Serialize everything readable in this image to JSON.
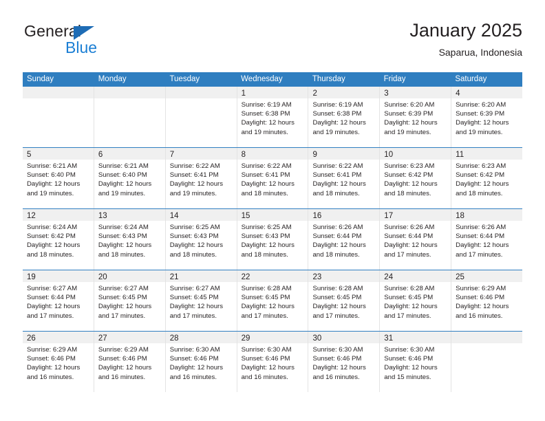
{
  "brand": {
    "line1": "General",
    "line2": "Blue",
    "triangle_icon": "triangle-icon",
    "color_dark": "#231f20",
    "color_blue": "#1c7fd4"
  },
  "header": {
    "title": "January 2025",
    "subtitle": "Saparua, Indonesia"
  },
  "theme": {
    "header_bg": "#2f7ec0",
    "daynum_bg": "#f0f0f0",
    "grid_line": "#e3e3e3",
    "text": "#231f20"
  },
  "weekdays": [
    "Sunday",
    "Monday",
    "Tuesday",
    "Wednesday",
    "Thursday",
    "Friday",
    "Saturday"
  ],
  "weeks": [
    [
      {
        "day": "",
        "sunrise": "",
        "sunset": "",
        "daylight_1": "",
        "daylight_2": ""
      },
      {
        "day": "",
        "sunrise": "",
        "sunset": "",
        "daylight_1": "",
        "daylight_2": ""
      },
      {
        "day": "",
        "sunrise": "",
        "sunset": "",
        "daylight_1": "",
        "daylight_2": ""
      },
      {
        "day": "1",
        "sunrise": "Sunrise: 6:19 AM",
        "sunset": "Sunset: 6:38 PM",
        "daylight_1": "Daylight: 12 hours",
        "daylight_2": "and 19 minutes."
      },
      {
        "day": "2",
        "sunrise": "Sunrise: 6:19 AM",
        "sunset": "Sunset: 6:38 PM",
        "daylight_1": "Daylight: 12 hours",
        "daylight_2": "and 19 minutes."
      },
      {
        "day": "3",
        "sunrise": "Sunrise: 6:20 AM",
        "sunset": "Sunset: 6:39 PM",
        "daylight_1": "Daylight: 12 hours",
        "daylight_2": "and 19 minutes."
      },
      {
        "day": "4",
        "sunrise": "Sunrise: 6:20 AM",
        "sunset": "Sunset: 6:39 PM",
        "daylight_1": "Daylight: 12 hours",
        "daylight_2": "and 19 minutes."
      }
    ],
    [
      {
        "day": "5",
        "sunrise": "Sunrise: 6:21 AM",
        "sunset": "Sunset: 6:40 PM",
        "daylight_1": "Daylight: 12 hours",
        "daylight_2": "and 19 minutes."
      },
      {
        "day": "6",
        "sunrise": "Sunrise: 6:21 AM",
        "sunset": "Sunset: 6:40 PM",
        "daylight_1": "Daylight: 12 hours",
        "daylight_2": "and 19 minutes."
      },
      {
        "day": "7",
        "sunrise": "Sunrise: 6:22 AM",
        "sunset": "Sunset: 6:41 PM",
        "daylight_1": "Daylight: 12 hours",
        "daylight_2": "and 19 minutes."
      },
      {
        "day": "8",
        "sunrise": "Sunrise: 6:22 AM",
        "sunset": "Sunset: 6:41 PM",
        "daylight_1": "Daylight: 12 hours",
        "daylight_2": "and 18 minutes."
      },
      {
        "day": "9",
        "sunrise": "Sunrise: 6:22 AM",
        "sunset": "Sunset: 6:41 PM",
        "daylight_1": "Daylight: 12 hours",
        "daylight_2": "and 18 minutes."
      },
      {
        "day": "10",
        "sunrise": "Sunrise: 6:23 AM",
        "sunset": "Sunset: 6:42 PM",
        "daylight_1": "Daylight: 12 hours",
        "daylight_2": "and 18 minutes."
      },
      {
        "day": "11",
        "sunrise": "Sunrise: 6:23 AM",
        "sunset": "Sunset: 6:42 PM",
        "daylight_1": "Daylight: 12 hours",
        "daylight_2": "and 18 minutes."
      }
    ],
    [
      {
        "day": "12",
        "sunrise": "Sunrise: 6:24 AM",
        "sunset": "Sunset: 6:42 PM",
        "daylight_1": "Daylight: 12 hours",
        "daylight_2": "and 18 minutes."
      },
      {
        "day": "13",
        "sunrise": "Sunrise: 6:24 AM",
        "sunset": "Sunset: 6:43 PM",
        "daylight_1": "Daylight: 12 hours",
        "daylight_2": "and 18 minutes."
      },
      {
        "day": "14",
        "sunrise": "Sunrise: 6:25 AM",
        "sunset": "Sunset: 6:43 PM",
        "daylight_1": "Daylight: 12 hours",
        "daylight_2": "and 18 minutes."
      },
      {
        "day": "15",
        "sunrise": "Sunrise: 6:25 AM",
        "sunset": "Sunset: 6:43 PM",
        "daylight_1": "Daylight: 12 hours",
        "daylight_2": "and 18 minutes."
      },
      {
        "day": "16",
        "sunrise": "Sunrise: 6:26 AM",
        "sunset": "Sunset: 6:44 PM",
        "daylight_1": "Daylight: 12 hours",
        "daylight_2": "and 18 minutes."
      },
      {
        "day": "17",
        "sunrise": "Sunrise: 6:26 AM",
        "sunset": "Sunset: 6:44 PM",
        "daylight_1": "Daylight: 12 hours",
        "daylight_2": "and 17 minutes."
      },
      {
        "day": "18",
        "sunrise": "Sunrise: 6:26 AM",
        "sunset": "Sunset: 6:44 PM",
        "daylight_1": "Daylight: 12 hours",
        "daylight_2": "and 17 minutes."
      }
    ],
    [
      {
        "day": "19",
        "sunrise": "Sunrise: 6:27 AM",
        "sunset": "Sunset: 6:44 PM",
        "daylight_1": "Daylight: 12 hours",
        "daylight_2": "and 17 minutes."
      },
      {
        "day": "20",
        "sunrise": "Sunrise: 6:27 AM",
        "sunset": "Sunset: 6:45 PM",
        "daylight_1": "Daylight: 12 hours",
        "daylight_2": "and 17 minutes."
      },
      {
        "day": "21",
        "sunrise": "Sunrise: 6:27 AM",
        "sunset": "Sunset: 6:45 PM",
        "daylight_1": "Daylight: 12 hours",
        "daylight_2": "and 17 minutes."
      },
      {
        "day": "22",
        "sunrise": "Sunrise: 6:28 AM",
        "sunset": "Sunset: 6:45 PM",
        "daylight_1": "Daylight: 12 hours",
        "daylight_2": "and 17 minutes."
      },
      {
        "day": "23",
        "sunrise": "Sunrise: 6:28 AM",
        "sunset": "Sunset: 6:45 PM",
        "daylight_1": "Daylight: 12 hours",
        "daylight_2": "and 17 minutes."
      },
      {
        "day": "24",
        "sunrise": "Sunrise: 6:28 AM",
        "sunset": "Sunset: 6:45 PM",
        "daylight_1": "Daylight: 12 hours",
        "daylight_2": "and 17 minutes."
      },
      {
        "day": "25",
        "sunrise": "Sunrise: 6:29 AM",
        "sunset": "Sunset: 6:46 PM",
        "daylight_1": "Daylight: 12 hours",
        "daylight_2": "and 16 minutes."
      }
    ],
    [
      {
        "day": "26",
        "sunrise": "Sunrise: 6:29 AM",
        "sunset": "Sunset: 6:46 PM",
        "daylight_1": "Daylight: 12 hours",
        "daylight_2": "and 16 minutes."
      },
      {
        "day": "27",
        "sunrise": "Sunrise: 6:29 AM",
        "sunset": "Sunset: 6:46 PM",
        "daylight_1": "Daylight: 12 hours",
        "daylight_2": "and 16 minutes."
      },
      {
        "day": "28",
        "sunrise": "Sunrise: 6:30 AM",
        "sunset": "Sunset: 6:46 PM",
        "daylight_1": "Daylight: 12 hours",
        "daylight_2": "and 16 minutes."
      },
      {
        "day": "29",
        "sunrise": "Sunrise: 6:30 AM",
        "sunset": "Sunset: 6:46 PM",
        "daylight_1": "Daylight: 12 hours",
        "daylight_2": "and 16 minutes."
      },
      {
        "day": "30",
        "sunrise": "Sunrise: 6:30 AM",
        "sunset": "Sunset: 6:46 PM",
        "daylight_1": "Daylight: 12 hours",
        "daylight_2": "and 16 minutes."
      },
      {
        "day": "31",
        "sunrise": "Sunrise: 6:30 AM",
        "sunset": "Sunset: 6:46 PM",
        "daylight_1": "Daylight: 12 hours",
        "daylight_2": "and 15 minutes."
      },
      {
        "day": "",
        "sunrise": "",
        "sunset": "",
        "daylight_1": "",
        "daylight_2": ""
      }
    ]
  ]
}
